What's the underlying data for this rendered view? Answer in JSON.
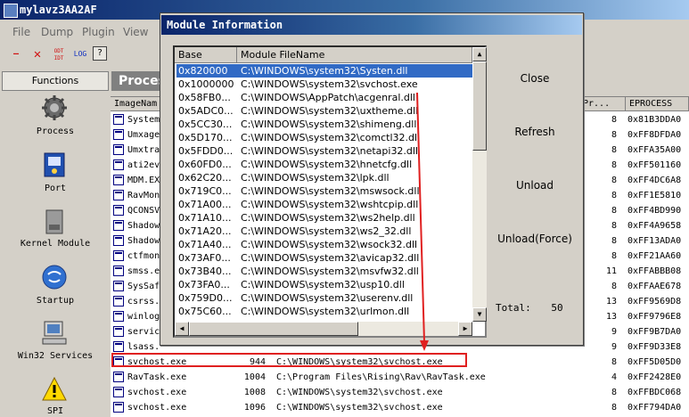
{
  "window": {
    "title": "mylavz3AA2AF"
  },
  "menu": [
    "File",
    "Dump",
    "Plugin",
    "View"
  ],
  "toolbar": [
    "—",
    "✕",
    "ODT IDT",
    "LOG",
    "?"
  ],
  "sidebar": {
    "title": "Functions",
    "items": [
      {
        "label": "Process",
        "icon": "gear-icon"
      },
      {
        "label": "Port",
        "icon": "port-icon"
      },
      {
        "label": "Kernel Module",
        "icon": "drive-icon"
      },
      {
        "label": "Startup",
        "icon": "startup-icon"
      },
      {
        "label": "Win32 Services",
        "icon": "computer-icon"
      },
      {
        "label": "SPI",
        "icon": "warning-icon"
      }
    ]
  },
  "process_panel": {
    "header": "Proces",
    "columns": [
      "ImageNam",
      "Pr...",
      "EPROCESS"
    ],
    "rows": [
      {
        "name": "System",
        "pid": "",
        "path": "",
        "pri": "8",
        "eprocess": "0x81B3DDA0"
      },
      {
        "name": "Umxage",
        "pid": "",
        "path": "",
        "pri": "8",
        "eprocess": "0xFF8DFDA0"
      },
      {
        "name": "Umxtra",
        "pid": "",
        "path": "",
        "pri": "8",
        "eprocess": "0xFFA35A00"
      },
      {
        "name": "ati2ev",
        "pid": "",
        "path": "",
        "pri": "8",
        "eprocess": "0xFF501160"
      },
      {
        "name": "MDM.EX",
        "pid": "",
        "path": "",
        "pri": "8",
        "eprocess": "0xFF4DC6A8"
      },
      {
        "name": "RavMon",
        "pid": "",
        "path": "",
        "pri": "8",
        "eprocess": "0xFF1E5810"
      },
      {
        "name": "QCONSV",
        "pid": "",
        "path": "",
        "pri": "8",
        "eprocess": "0xFF4BD990"
      },
      {
        "name": "Shadow",
        "pid": "",
        "path": "",
        "pri": "8",
        "eprocess": "0xFF4A9658"
      },
      {
        "name": "Shadow",
        "pid": "",
        "path": "",
        "pri": "8",
        "eprocess": "0xFF13ADA0"
      },
      {
        "name": "ctfmon",
        "pid": "",
        "path": "",
        "pri": "8",
        "eprocess": "0xFF21AA60"
      },
      {
        "name": "smss.e",
        "pid": "",
        "path": "",
        "pri": "11",
        "eprocess": "0xFFABBB08"
      },
      {
        "name": "SysSaf",
        "pid": "",
        "path": "",
        "pri": "8",
        "eprocess": "0xFFAAE678"
      },
      {
        "name": "csrss.",
        "pid": "",
        "path": "",
        "pri": "13",
        "eprocess": "0xFF9569D8"
      },
      {
        "name": "winlog",
        "pid": "",
        "path": "",
        "pri": "13",
        "eprocess": "0xFF9796E8"
      },
      {
        "name": "servic",
        "pid": "",
        "path": "",
        "pri": "9",
        "eprocess": "0xFF9B7DA0"
      },
      {
        "name": "lsass.",
        "pid": "",
        "path": "",
        "pri": "9",
        "eprocess": "0xFF9D33E8"
      },
      {
        "name": "svchost.exe",
        "pid": "944",
        "path": "C:\\WINDOWS\\system32\\svchost.exe",
        "pri": "8",
        "eprocess": "0xFF5D05D0"
      },
      {
        "name": "RavTask.exe",
        "pid": "1004",
        "path": "C:\\Program Files\\Rising\\Rav\\RavTask.exe",
        "pri": "4",
        "eprocess": "0xFF2428E0"
      },
      {
        "name": "svchost.exe",
        "pid": "1008",
        "path": "C:\\WINDOWS\\system32\\svchost.exe",
        "pri": "8",
        "eprocess": "0xFFBDC068"
      },
      {
        "name": "svchost.exe",
        "pid": "1096",
        "path": "C:\\WINDOWS\\system32\\svchost.exe",
        "pri": "8",
        "eprocess": "0xFF794DA0"
      }
    ]
  },
  "dialog": {
    "title": "Module Information",
    "columns": [
      "Base",
      "Module FileName"
    ],
    "modules": [
      {
        "base": "0x820000",
        "file": "C:\\WINDOWS\\system32\\Systen.dll"
      },
      {
        "base": "0x1000000",
        "file": "C:\\WINDOWS\\system32\\svchost.exe"
      },
      {
        "base": "0x58FB0...",
        "file": "C:\\WINDOWS\\AppPatch\\acgenral.dll"
      },
      {
        "base": "0x5ADC0...",
        "file": "C:\\WINDOWS\\system32\\uxtheme.dll"
      },
      {
        "base": "0x5CC30...",
        "file": "C:\\WINDOWS\\system32\\shimeng.dll"
      },
      {
        "base": "0x5D170...",
        "file": "C:\\WINDOWS\\system32\\comctl32.dll"
      },
      {
        "base": "0x5FDD0...",
        "file": "C:\\WINDOWS\\system32\\netapi32.dll"
      },
      {
        "base": "0x60FD0...",
        "file": "C:\\WINDOWS\\system32\\hnetcfg.dll"
      },
      {
        "base": "0x62C20...",
        "file": "C:\\WINDOWS\\system32\\lpk.dll"
      },
      {
        "base": "0x719C0...",
        "file": "C:\\WINDOWS\\system32\\mswsock.dll"
      },
      {
        "base": "0x71A00...",
        "file": "C:\\WINDOWS\\system32\\wshtcpip.dll"
      },
      {
        "base": "0x71A10...",
        "file": "C:\\WINDOWS\\system32\\ws2help.dll"
      },
      {
        "base": "0x71A20...",
        "file": "C:\\WINDOWS\\system32\\ws2_32.dll"
      },
      {
        "base": "0x71A40...",
        "file": "C:\\WINDOWS\\system32\\wsock32.dll"
      },
      {
        "base": "0x73AF0...",
        "file": "C:\\WINDOWS\\system32\\avicap32.dll"
      },
      {
        "base": "0x73B40...",
        "file": "C:\\WINDOWS\\system32\\msvfw32.dll"
      },
      {
        "base": "0x73FA0...",
        "file": "C:\\WINDOWS\\system32\\usp10.dll"
      },
      {
        "base": "0x759D0...",
        "file": "C:\\WINDOWS\\system32\\userenv.dll"
      },
      {
        "base": "0x75C60...",
        "file": "C:\\WINDOWS\\system32\\urlmon.dll"
      }
    ],
    "buttons": {
      "close": "Close",
      "refresh": "Refresh",
      "unload": "Unload",
      "unload_force": "Unload(Force)"
    },
    "total_label": "Total:",
    "total_value": "50"
  },
  "colors": {
    "title_bar": "#0a246a",
    "selection": "#316ac5",
    "highlight_box": "#e02020",
    "arrow": "#e02020"
  }
}
